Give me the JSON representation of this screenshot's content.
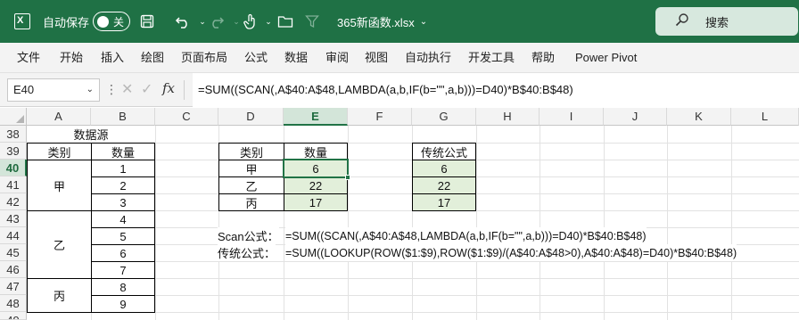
{
  "titlebar": {
    "autosave_label": "自动保存",
    "autosave_state": "关",
    "filename": "365新函数.xlsx",
    "search_label": "搜索"
  },
  "ribbon": {
    "tabs": [
      "文件",
      "开始",
      "插入",
      "绘图",
      "页面布局",
      "公式",
      "数据",
      "审阅",
      "视图",
      "自动执行",
      "开发工具",
      "帮助",
      "Power Pivot"
    ]
  },
  "formula_bar": {
    "name_box": "E40",
    "formula": "=SUM((SCAN(,A$40:A$48,LAMBDA(a,b,IF(b=\"\",a,b)))=D40)*B$40:B$48)"
  },
  "sheet": {
    "columns": [
      "A",
      "B",
      "C",
      "D",
      "E",
      "F",
      "G",
      "H",
      "I",
      "J",
      "K",
      "L"
    ],
    "rows": [
      "38",
      "39",
      "40",
      "41",
      "42",
      "43",
      "44",
      "45",
      "46",
      "47",
      "48",
      "49"
    ],
    "source": {
      "title": "数据源",
      "header_category": "类别",
      "header_qty": "数量",
      "categories": [
        "甲",
        "乙",
        "丙"
      ],
      "quantities": [
        "1",
        "2",
        "3",
        "4",
        "5",
        "6",
        "7",
        "8",
        "9"
      ]
    },
    "result": {
      "header_category": "类别",
      "header_qty": "数量",
      "categories": [
        "甲",
        "乙",
        "丙"
      ],
      "values": [
        "6",
        "22",
        "17"
      ]
    },
    "traditional": {
      "header": "传统公式",
      "values": [
        "6",
        "22",
        "17"
      ]
    },
    "notes": {
      "scan_label": "Scan公式：",
      "scan_formula": "=SUM((SCAN(,A$40:A$48,LAMBDA(a,b,IF(b=\"\",a,b)))=D40)*B$40:B$48)",
      "trad_label": "传统公式：",
      "trad_formula": "=SUM((LOOKUP(ROW($1:$9),ROW($1:$9)/(A$40:A$48>0),A$40:A$48)=D40)*B$40:B$48)"
    }
  },
  "colors": {
    "title_bar": "#1f7145",
    "accent": "#217346",
    "cell_fill": "#e2efda"
  },
  "icons": [
    "excel-logo-icon",
    "save-icon",
    "undo-icon",
    "redo-icon",
    "touch-mode-icon",
    "folder-icon",
    "filter-icon",
    "search-icon",
    "cancel-icon",
    "enter-icon",
    "fx-icon"
  ]
}
